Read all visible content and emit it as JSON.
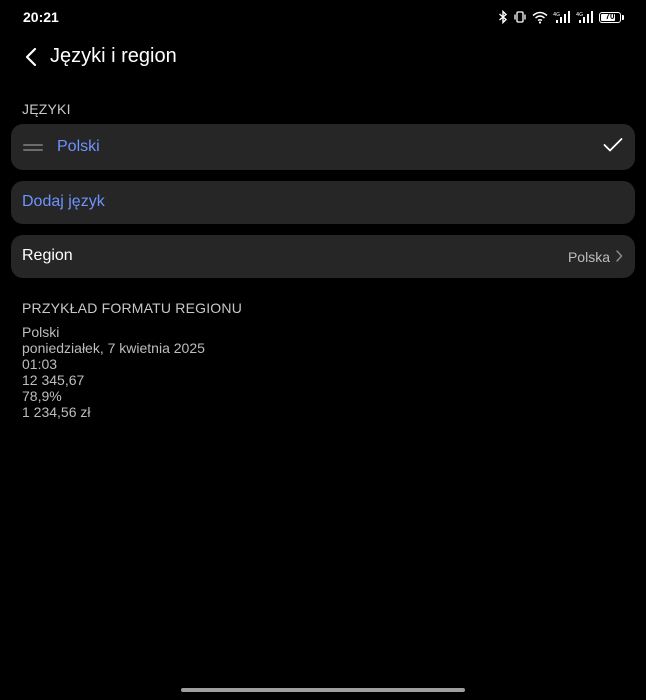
{
  "status_bar": {
    "time": "20:21",
    "battery_level": "70",
    "icons": [
      "bluetooth-icon",
      "vibrate-icon",
      "wifi-icon",
      "signal-icon",
      "signal-icon",
      "battery-icon"
    ]
  },
  "header": {
    "title": "Języki i region",
    "back_icon": "chevron-left-icon"
  },
  "languages_section": {
    "label": "JĘZYKI",
    "items": [
      {
        "label": "Polski",
        "selected": true,
        "icon": "check-icon"
      }
    ],
    "add_label": "Dodaj język"
  },
  "region": {
    "label": "Region",
    "value": "Polska"
  },
  "format_example": {
    "label": "PRZYKŁAD FORMATU REGIONU",
    "lines": [
      "Polski",
      "poniedziałek, 7 kwietnia 2025",
      "01:03",
      "12 345,67",
      "78,9%",
      "1 234,56 zł"
    ]
  },
  "colors": {
    "accent": "#6f93ff",
    "card_bg": "#262626",
    "background": "#000000"
  }
}
